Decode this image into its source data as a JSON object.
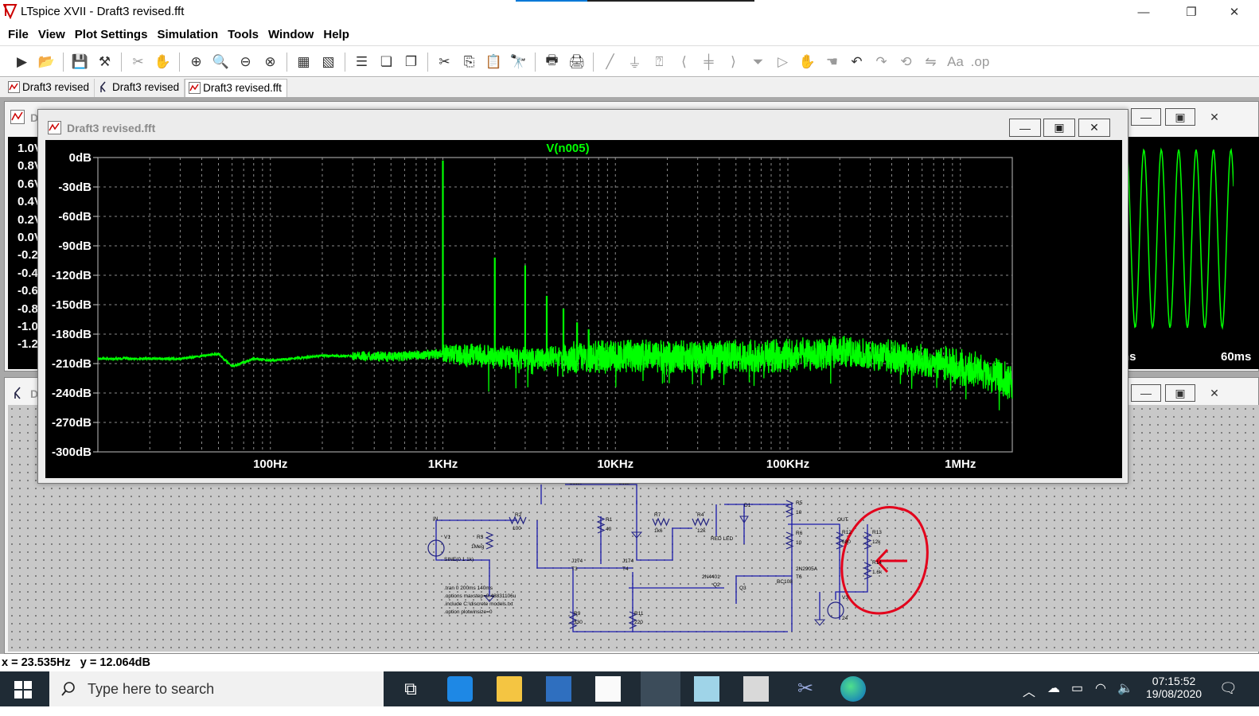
{
  "window": {
    "title": "LTspice XVII - Draft3 revised.fft",
    "minimize": "—",
    "maximize": "❐",
    "close": "✕"
  },
  "menu": [
    "File",
    "View",
    "Plot Settings",
    "Simulation",
    "Tools",
    "Window",
    "Help"
  ],
  "toolbar": {
    "buttons": [
      "run-icon",
      "open-icon",
      "save-icon",
      "control-panel-icon",
      "halt-icon",
      "pan-icon",
      "zoom-in-icon",
      "zoom-area-icon",
      "zoom-out-icon",
      "zoom-fit-icon",
      "autorange-icon",
      "delete-trace-icon",
      "tile-horizontal-icon",
      "tile-vertical-icon",
      "cascade-icon",
      "cut-icon",
      "copy-icon",
      "paste-icon",
      "find-icon",
      "print-icon",
      "print-setup-icon",
      "wire-icon",
      "ground-icon",
      "label-icon",
      "resistor-icon",
      "capacitor-icon",
      "inductor-icon",
      "diode-icon",
      "component-icon",
      "move-icon",
      "drag-icon",
      "undo-icon",
      "redo-icon",
      "rotate-icon",
      "mirror-icon",
      "text-icon",
      "spice-directive-icon"
    ]
  },
  "doc_tabs": [
    {
      "label": "Draft3 revised",
      "icon": "waveform-icon"
    },
    {
      "label": "Draft3 revised",
      "icon": "schematic-icon"
    },
    {
      "label": "Draft3 revised.fft",
      "icon": "waveform-icon"
    }
  ],
  "bg_waveform_window": {
    "title": "D",
    "y_ticks": [
      "1.0V",
      "0.8V",
      "0.6V",
      "0.4V",
      "0.2V",
      "0.0V",
      "-0.2V",
      "-0.4V",
      "-0.6V",
      "-0.8V",
      "-1.0V",
      "-1.2V"
    ],
    "x_ticks_visible": [
      "ns",
      "60ms"
    ]
  },
  "bg_schematic_window": {
    "title": "D"
  },
  "fft_window": {
    "title": "Draft3 revised.fft",
    "trace_color": "#00ff00"
  },
  "chart_data": {
    "type": "line",
    "title": "V(n005)",
    "xlabel": "",
    "ylabel": "",
    "x_scale": "log",
    "xlim": [
      10,
      2000000
    ],
    "ylim": [
      -300,
      0
    ],
    "x_tick_labels": [
      "100Hz",
      "1KHz",
      "10KHz",
      "100KHz",
      "1MHz"
    ],
    "x_tick_values": [
      100,
      1000,
      10000,
      100000,
      1000000
    ],
    "y_tick_labels": [
      "0dB",
      "-30dB",
      "-60dB",
      "-90dB",
      "-120dB",
      "-150dB",
      "-180dB",
      "-210dB",
      "-240dB",
      "-270dB",
      "-300dB"
    ],
    "y_tick_values": [
      0,
      -30,
      -60,
      -90,
      -120,
      -150,
      -180,
      -210,
      -240,
      -270,
      -300
    ],
    "grid": true,
    "background": "#000000",
    "series": [
      {
        "name": "V(n005)",
        "color": "#00ff00",
        "noise_floor": {
          "x": [
            10,
            30,
            50,
            60,
            80,
            100,
            200,
            500,
            1000,
            3000,
            10000,
            30000,
            100000,
            200000,
            400000,
            800000,
            1500000,
            2000000
          ],
          "y": [
            -205,
            -205,
            -200,
            -213,
            -205,
            -207,
            -202,
            -203,
            -200,
            -205,
            -203,
            -203,
            -202,
            -198,
            -203,
            -210,
            -220,
            -230
          ]
        },
        "peaks": [
          {
            "x": 1000,
            "y": -3
          },
          {
            "x": 2000,
            "y": -102
          },
          {
            "x": 3000,
            "y": -110
          },
          {
            "x": 4000,
            "y": -141
          },
          {
            "x": 5000,
            "y": -154
          },
          {
            "x": 6000,
            "y": -168
          },
          {
            "x": 7000,
            "y": -175
          }
        ]
      }
    ]
  },
  "schematic": {
    "labels": [
      "IN",
      "V1",
      "SINE(0 1 1k)",
      "R3",
      "1Meg",
      "R2",
      "100",
      "R1",
      "40",
      "R7",
      "1k6",
      "R4",
      "12k",
      "D1",
      "RED LED",
      "R5",
      "10",
      "R6",
      "10",
      "OUT",
      "R12",
      "680",
      "R13",
      "12k",
      "R14",
      "1.6k",
      "V3",
      "24",
      "T3",
      "T4",
      "J174",
      "J174",
      "J112",
      "J112",
      "2N4401",
      "Q2",
      "2N2905A",
      "T6",
      "BC108",
      "Q3",
      "R9",
      "330",
      "R11",
      "220",
      ".tran 0 200ms 140ms",
      ".options maxstep=0.48831106u",
      ".include C:\\discrete models.txt",
      ".option plotwinsize=0"
    ],
    "annotation_color": "#e3001b"
  },
  "status": {
    "cursor": "x = 23.535Hz   y = 12.064dB"
  },
  "taskbar": {
    "search_placeholder": "Type here to search",
    "time": "07:15:52",
    "date": "19/08/2020"
  }
}
